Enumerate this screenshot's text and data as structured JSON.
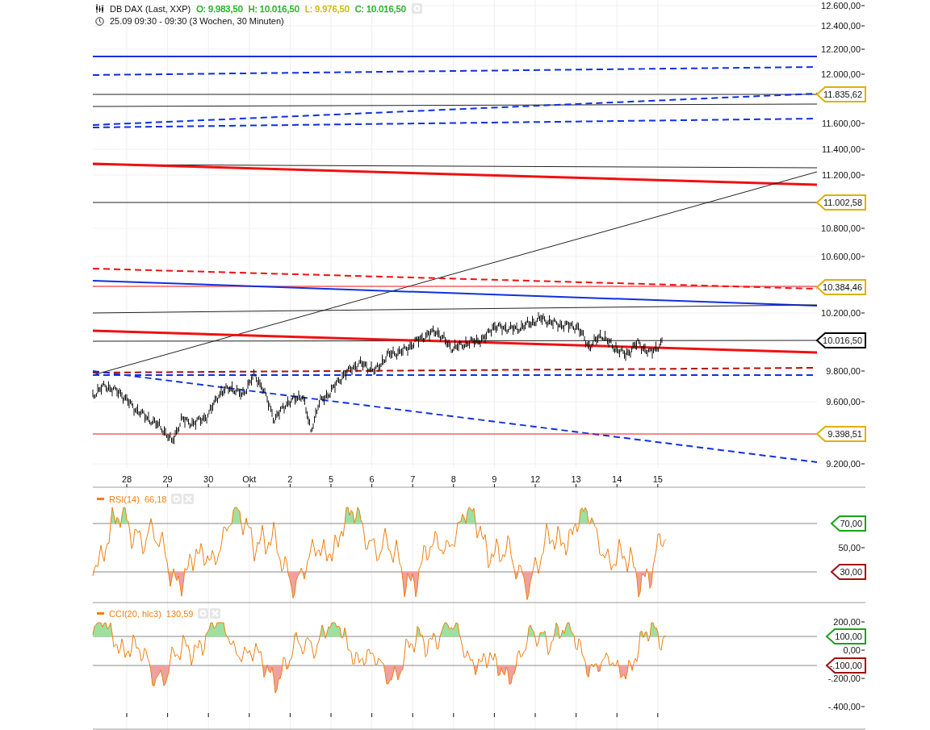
{
  "header": {
    "title": "DB DAX (Last, XXP)",
    "quotes": [
      {
        "text": "O: 9.983,50",
        "color": "#1fae1f"
      },
      {
        "text": "H: 10.016,50",
        "color": "#1fae1f"
      },
      {
        "text": "L: 9.976,50",
        "color": "#c9b800"
      },
      {
        "text": "C: 10.016,50",
        "color": "#1fae1f"
      }
    ],
    "period": "25.09 09:30 - 09:30 (3 Wochen, 30 Minuten)"
  },
  "price_axis": {
    "ticks": [
      "12.600,00",
      "12.400,00",
      "12.200,00",
      "12.000,00",
      "11.600,00",
      "11.400,00",
      "11.200,00",
      "10.800,00",
      "10.600,00",
      "10.200,00",
      "9.800,00",
      "9.600,00",
      "9.200,00"
    ],
    "markers": [
      {
        "label": "11.835,62",
        "color": "#e0b000"
      },
      {
        "label": "11.002,58",
        "color": "#e0b000"
      },
      {
        "label": "10.384,46",
        "color": "#e0b000"
      },
      {
        "label": "10.016,50",
        "color": "#000000"
      },
      {
        "label": "9.398,51",
        "color": "#e0b000"
      }
    ]
  },
  "time_axis": {
    "labels": [
      "28",
      "29",
      "30",
      "Okt",
      "2",
      "5",
      "6",
      "7",
      "8",
      "9",
      "12",
      "13",
      "14",
      "15"
    ]
  },
  "rsi": {
    "name": "RSI(14)",
    "value": "66,18",
    "ticks": [
      "50,00"
    ],
    "markers": [
      {
        "label": "70,00",
        "color": "#1aa31a"
      },
      {
        "label": "30,00",
        "color": "#a01010"
      }
    ]
  },
  "cci": {
    "name": "CCI(20, hlc3)",
    "value": "130,59",
    "ticks": [
      "200,00",
      "0,00",
      "-.200,00",
      "-.400,00"
    ],
    "markers": [
      {
        "label": "100,00",
        "color": "#1aa31a"
      },
      {
        "label": "-.100,00",
        "color": "#a01010"
      }
    ]
  }
}
